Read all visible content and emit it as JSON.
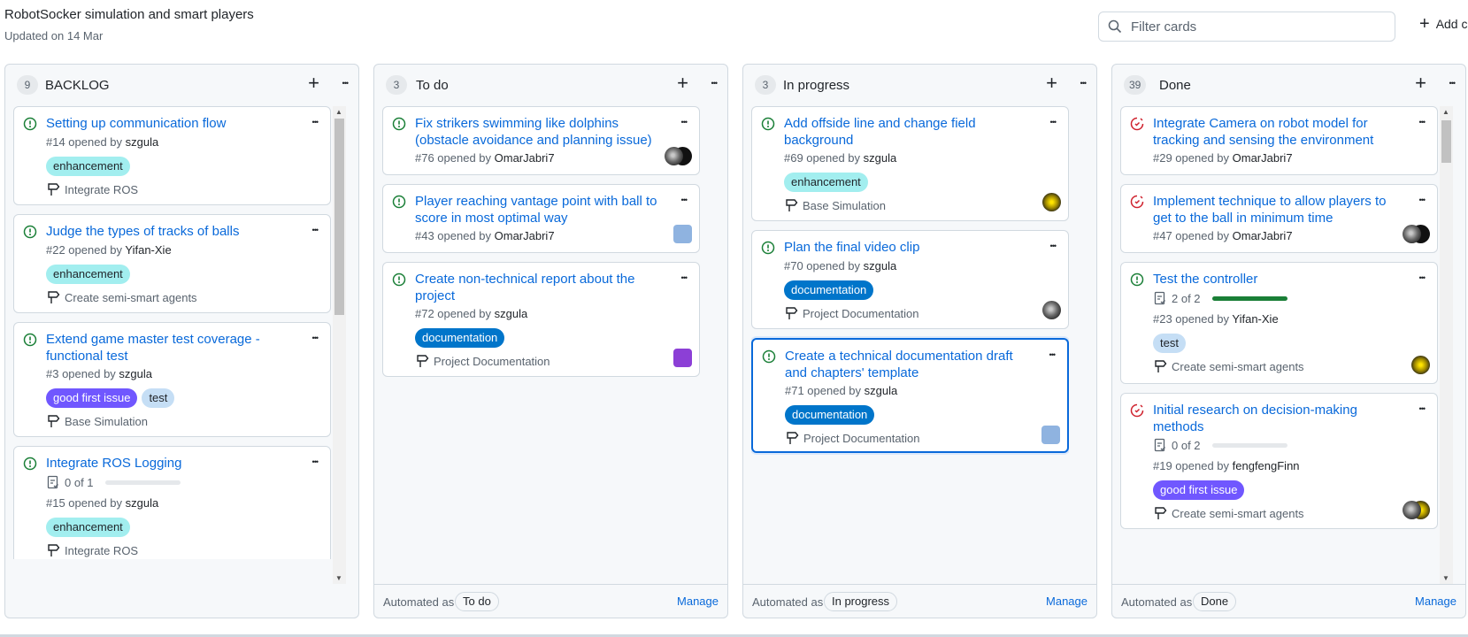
{
  "project": {
    "title": "RobotSocker simulation and smart players",
    "updated": "Updated on 14 Mar"
  },
  "filter": {
    "placeholder": "Filter cards"
  },
  "add_column": {
    "label": "Add c"
  },
  "columns": [
    {
      "name": "BACKLOG",
      "count": "9",
      "automated": "",
      "cards": [
        {
          "title": "Setting up communication flow",
          "number": "#14 opened by ",
          "user": "szgula",
          "labels": [
            "enhancement"
          ],
          "milestone": "Integrate ROS"
        },
        {
          "title": "Judge the types of tracks of balls",
          "number": "#22 opened by ",
          "user": "Yifan-Xie",
          "labels": [
            "enhancement"
          ],
          "milestone": "Create semi-smart agents"
        },
        {
          "title": "Extend game master test coverage - functional test",
          "number": "#3 opened by ",
          "user": "szgula",
          "labels": [
            "good first issue",
            "test"
          ],
          "milestone": "Base Simulation"
        },
        {
          "title": "Integrate ROS Logging",
          "progress": "0 of 1",
          "progress_value": 0,
          "number": "#15 opened by ",
          "user": "szgula",
          "labels": [
            "enhancement"
          ],
          "milestone": "Integrate ROS"
        }
      ]
    },
    {
      "name": "To do",
      "count": "3",
      "automated": "To do",
      "cards": [
        {
          "title": "Fix strikers swimming like dolphins (obstacle avoidance and planning issue)",
          "number": "#76 opened by ",
          "user": "OmarJabri7",
          "labels": [],
          "milestone": ""
        },
        {
          "title": "Player reaching vantage point with ball to score in most optimal way",
          "number": "#43 opened by ",
          "user": "OmarJabri7",
          "labels": [],
          "milestone": ""
        },
        {
          "title": "Create non-technical report about the project",
          "number": "#72 opened by ",
          "user": "szgula",
          "labels": [
            "documentation"
          ],
          "milestone": "Project Documentation"
        }
      ]
    },
    {
      "name": "In progress",
      "count": "3",
      "automated": "In progress",
      "cards": [
        {
          "title": "Add offside line and change field background",
          "number": "#69 opened by ",
          "user": "szgula",
          "labels": [
            "enhancement"
          ],
          "milestone": "Base Simulation"
        },
        {
          "title": "Plan the final video clip",
          "number": "#70 opened by ",
          "user": "szgula",
          "labels": [
            "documentation"
          ],
          "milestone": "Project Documentation"
        },
        {
          "title": "Create a technical documentation draft and chapters' template",
          "number": "#71 opened by ",
          "user": "szgula",
          "labels": [
            "documentation"
          ],
          "milestone": "Project Documentation"
        }
      ]
    },
    {
      "name": "Done",
      "count": "39",
      "automated": "Done",
      "cards": [
        {
          "title": "Integrate Camera on robot model for tracking and sensing the environment",
          "number": "#29 opened by ",
          "user": "OmarJabri7",
          "labels": [],
          "milestone": ""
        },
        {
          "title": "Implement technique to allow players to get to the ball in minimum time",
          "number": "#47 opened by ",
          "user": "OmarJabri7",
          "labels": [],
          "milestone": ""
        },
        {
          "title": "Test the controller",
          "progress": "2 of 2",
          "progress_value": 1,
          "number": "#23 opened by ",
          "user": "Yifan-Xie",
          "labels": [
            "test"
          ],
          "milestone": "Create semi-smart agents"
        },
        {
          "title": "Initial research on decision-making methods",
          "progress": "0 of 2",
          "progress_value": 0,
          "number": "#19 opened by ",
          "user": "fengfengFinn",
          "labels": [
            "good first issue"
          ],
          "milestone": "Create semi-smart agents"
        }
      ]
    }
  ],
  "footer": {
    "automated_prefix": "Automated as",
    "manage": "Manage"
  },
  "colors": {
    "enhancement": "#a2eeef",
    "documentation": "#0075ca",
    "good_first_issue": "#7057ff",
    "test": "#c5def5",
    "open_icon": "#1a7f37",
    "closed_icon": "#cf222e",
    "link": "#0969da"
  }
}
